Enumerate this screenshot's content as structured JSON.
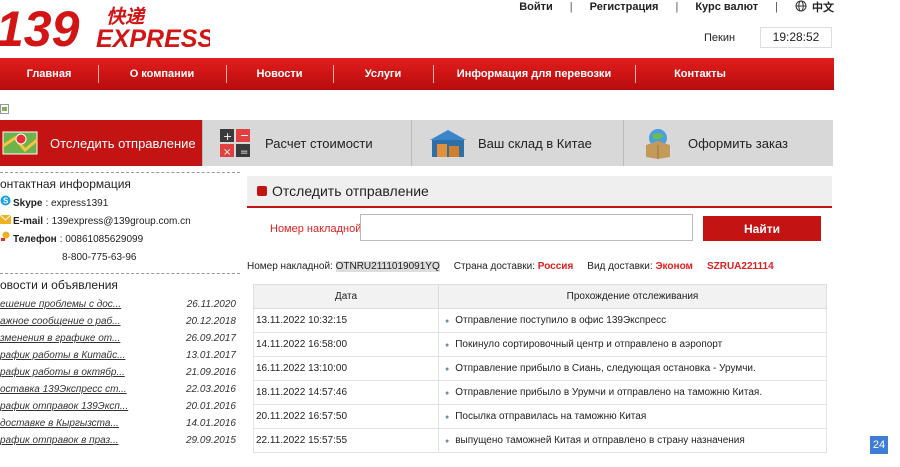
{
  "header": {
    "logo_number": "139",
    "logo_cn": "快递",
    "logo_express": "EXPRESS",
    "links": [
      "Войти",
      "Регистрация",
      "Курс валют",
      "中文"
    ],
    "clock_city": "Пекин",
    "clock_time": "19:28:52"
  },
  "nav": [
    "Главная",
    "О компании",
    "Новости",
    "Услуги",
    "Информация для перевозки",
    "Контакты"
  ],
  "tabs": [
    {
      "label": "Отследить отправление",
      "active": true,
      "icon": "map-pin-icon"
    },
    {
      "label": "Расчет стоимости",
      "active": false,
      "icon": "calculator-icon"
    },
    {
      "label": "Ваш склад в Китае",
      "active": false,
      "icon": "warehouse-icon"
    },
    {
      "label": "Оформить заказ",
      "active": false,
      "icon": "globe-box-icon"
    }
  ],
  "sidebar": {
    "contact_title": "онтактная информация",
    "skype_label": "Skype",
    "skype_value": "express1391",
    "email_label": "E-mail",
    "email_value": "139express@139group.com.cn",
    "phone_label": "Телефон",
    "phone_value": "00861085629099",
    "phone_value_2": "8-800-775-63-96",
    "news_title": "овости и объявления",
    "news": [
      {
        "title": "ешение проблемы с дос...",
        "date": "26.11.2020"
      },
      {
        "title": "ажное сообщение о раб...",
        "date": "20.12.2018"
      },
      {
        "title": "зменения в графике от...",
        "date": "26.09.2017"
      },
      {
        "title": "рафик работы в Китайс...",
        "date": "13.01.2017"
      },
      {
        "title": "рафик работы в октябр...",
        "date": "21.09.2016"
      },
      {
        "title": "оставка 139Экспресс ст...",
        "date": "22.03.2016"
      },
      {
        "title": "рафик отправок 139Эксп...",
        "date": "20.01.2016"
      },
      {
        "title": "доставке в Кыргызста...",
        "date": "14.01.2016"
      },
      {
        "title": "рафик отправок в праз...",
        "date": "29.09.2015"
      }
    ]
  },
  "main": {
    "title": "Отследить отправление",
    "label_number": "Номер накладной:",
    "input_value": "",
    "find_button": "Найти",
    "info_label_number": "Номер накладной:",
    "info_number": "OTNRU2111019091YQ",
    "info_label_country": "Страна доставки:",
    "info_country": "Россия",
    "info_label_type": "Вид доставки:",
    "info_type": "Эконом",
    "info_code": "SZRUA221114",
    "table_headers": [
      "Дата",
      "Прохождение отслеживания"
    ],
    "rows": [
      {
        "date": "13.11.2022 10:32:15",
        "status": "Отправление поступило в офис 139Экспресс"
      },
      {
        "date": "14.11.2022 16:58:00",
        "status": "Покинуло сортировочный центр и отправлено в аэропорт"
      },
      {
        "date": "16.11.2022 13:10:00",
        "status": "Отправление прибыло в Сиань, следующая остановка - Урумчи."
      },
      {
        "date": "18.11.2022 14:57:46",
        "status": "Отправление прибыло в Урумчи и отправлено на таможню Китая."
      },
      {
        "date": "20.11.2022 16:57:50",
        "status": "Посылка отправилась на таможню Китая"
      },
      {
        "date": "22.11.2022 15:57:55",
        "status": "выпущено таможней Китая и отправлено в страну назначения"
      }
    ]
  },
  "badge": "24",
  "colors": {
    "brand_red": "#c31313",
    "nav_red": "#e21d1d",
    "tab_gray": "#d8d8d8"
  }
}
